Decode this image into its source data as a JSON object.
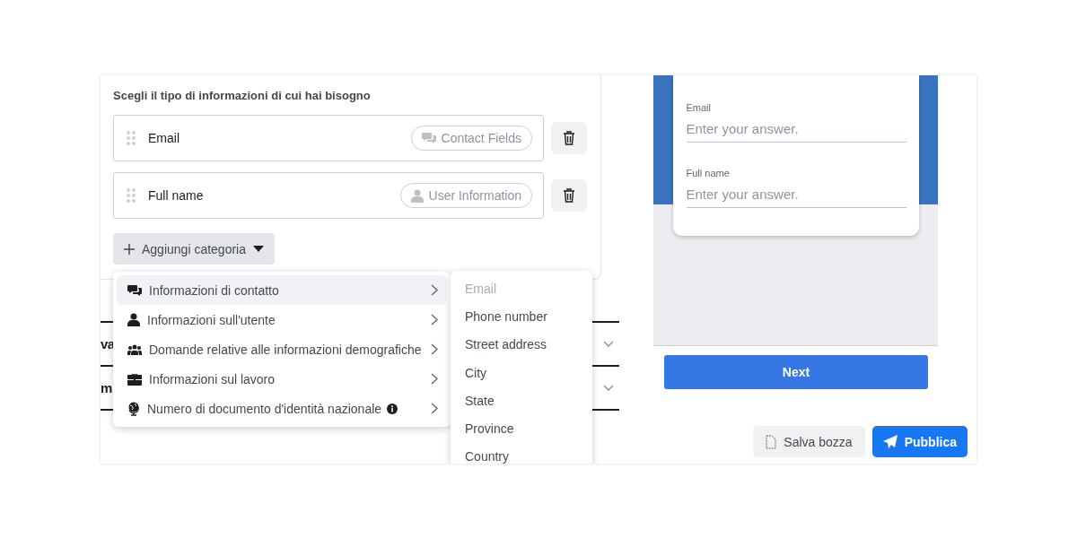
{
  "section": {
    "title": "Scegli il tipo di informazioni di cui hai bisogno",
    "fields": [
      {
        "label": "Email",
        "tag": "Contact Fields",
        "kind": "contact"
      },
      {
        "label": "Full name",
        "tag": "User Information",
        "kind": "user"
      }
    ],
    "add_button": "Aggiungi categoria"
  },
  "accordion": [
    {
      "title": "va"
    },
    {
      "title": "m"
    }
  ],
  "menu": {
    "items": [
      {
        "label": "Informazioni di contatto",
        "kind": "contact",
        "selected": true,
        "info": false
      },
      {
        "label": "Informazioni sull'utente",
        "kind": "user",
        "selected": false,
        "info": false
      },
      {
        "label": "Domande relative alle informazioni demografiche",
        "kind": "demographic",
        "selected": false,
        "info": false
      },
      {
        "label": "Informazioni sul lavoro",
        "kind": "work",
        "selected": false,
        "info": false
      },
      {
        "label": "Numero di documento d'identità nazionale",
        "kind": "id",
        "selected": false,
        "info": true
      }
    ],
    "submenu": [
      {
        "label": "Email",
        "disabled": true
      },
      {
        "label": "Phone number",
        "disabled": false
      },
      {
        "label": "Street address",
        "disabled": false
      },
      {
        "label": "City",
        "disabled": false
      },
      {
        "label": "State",
        "disabled": false
      },
      {
        "label": "Province",
        "disabled": false
      },
      {
        "label": "Country",
        "disabled": false
      }
    ]
  },
  "preview": {
    "questions": [
      {
        "label": "Email",
        "placeholder": "Enter your answer."
      },
      {
        "label": "Full name",
        "placeholder": "Enter your answer."
      }
    ],
    "next_button": "Next"
  },
  "footer": {
    "draft_button": "Salva bozza",
    "publish_button": "Pubblica"
  }
}
